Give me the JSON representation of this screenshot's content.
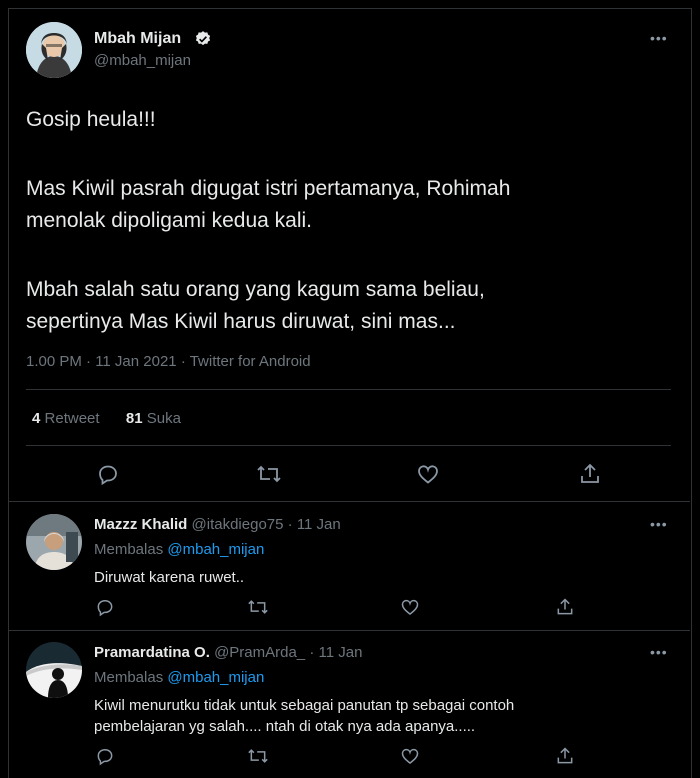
{
  "main_tweet": {
    "display_name": "Mbah Mijan",
    "handle": "@mbah_mijan",
    "text_lines": [
      "Gosip heula!!!",
      "Mas Kiwil pasrah digugat istri pertamanya, Rohimah",
      "menolak dipoligami kedua kali.",
      "Mbah salah satu orang yang kagum sama beliau,",
      "sepertinya Mas Kiwil harus diruwat, sini mas..."
    ],
    "meta": "1.00 PM · 11 Jan 2021 · Twitter for Android",
    "retweet_count": "4",
    "retweet_label": "Retweet",
    "like_count": "81",
    "like_label": "Suka",
    "more_label": "•••"
  },
  "replies": [
    {
      "display_name": "Mazzz Khalid",
      "handle": "@itakdiego75",
      "date": "· 11 Jan",
      "replying_prefix": "Membalas",
      "replying_to": "@mbah_mijan",
      "text_lines": [
        "Diruwat karena ruwet.."
      ],
      "more_label": "•••"
    },
    {
      "display_name": "Pramardatina O.",
      "handle": "@PramArda_",
      "date": "· 11 Jan",
      "replying_prefix": "Membalas",
      "replying_to": "@mbah_mijan",
      "text_lines": [
        "Kiwil menurutku tidak untuk sebagai panutan tp sebagai contoh",
        "pembelajaran yg salah.... ntah di otak nya ada apanya....."
      ],
      "more_label": "•••"
    }
  ],
  "icons": [
    "reply-icon",
    "retweet-icon",
    "like-icon",
    "share-icon",
    "verified-badge-icon",
    "more-icon"
  ]
}
